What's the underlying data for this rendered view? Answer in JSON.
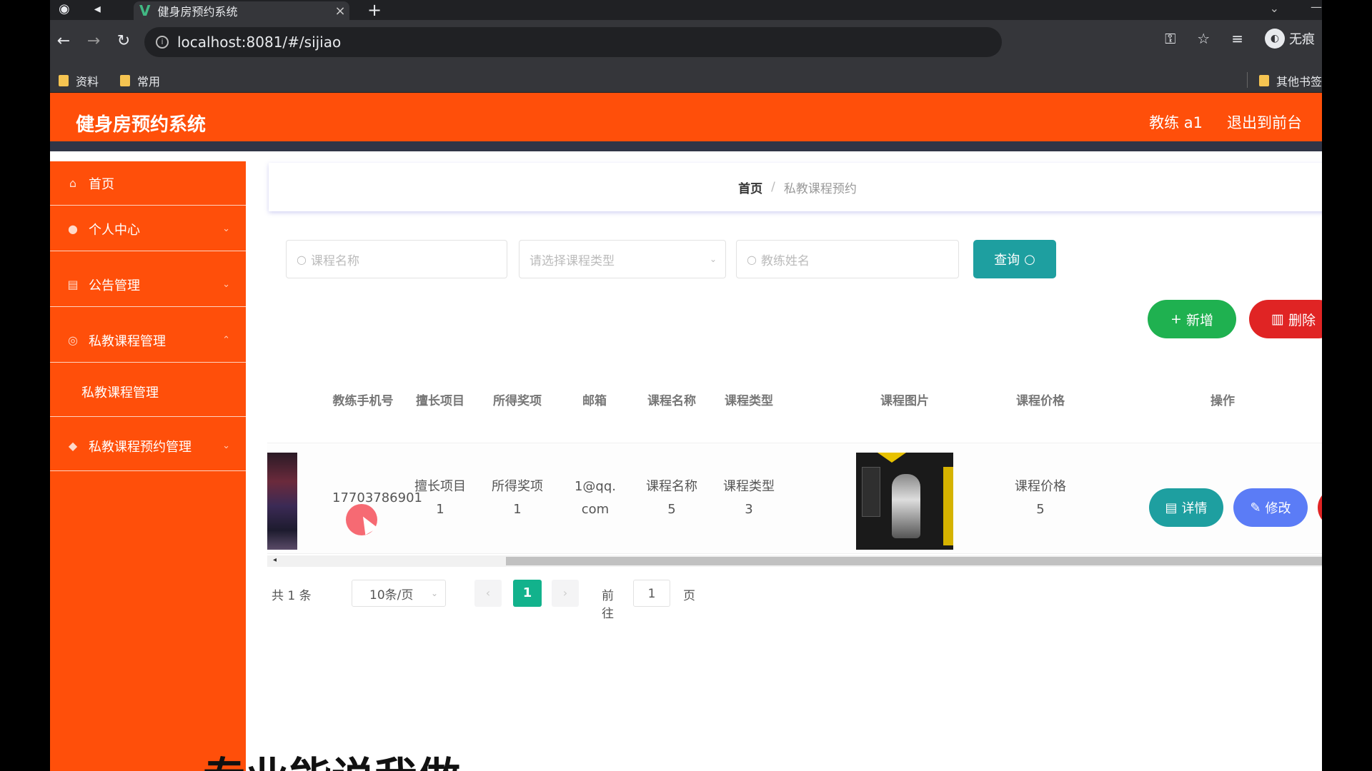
{
  "browser": {
    "tab_title": "健身房预约系统",
    "tab_logo": "V",
    "tab_close": "×",
    "new_tab": "+",
    "url": "localhost:8081/#/sijiao",
    "bookmarks": [
      "资料",
      "常用"
    ],
    "other_bookmarks": "其他书签",
    "profile_label": "无痕"
  },
  "header": {
    "title": "健身房预约系统",
    "user_label": "教练 a1",
    "logout_label": "退出到前台"
  },
  "sidebar": {
    "items": [
      {
        "label": "首页",
        "icon": "home-icon"
      },
      {
        "label": "个人中心",
        "icon": "user-icon"
      },
      {
        "label": "公告管理",
        "icon": "notice-icon"
      },
      {
        "label": "私教课程管理",
        "icon": "course-icon"
      },
      {
        "label": "私教课程预约管理",
        "icon": "booking-icon"
      }
    ],
    "submenu": {
      "label": "私教课程管理"
    }
  },
  "breadcrumb": {
    "home": "首页",
    "separator": "/",
    "current": "私教课程预约"
  },
  "search": {
    "course_name_placeholder": "课程名称",
    "course_type_placeholder": "请选择课程类型",
    "coach_name_placeholder": "教练姓名",
    "query_label": "查询"
  },
  "actions": {
    "add_label": "新增",
    "delete_label": "删除"
  },
  "table": {
    "headers": [
      "教练手机号",
      "擅长项目",
      "所得奖项",
      "邮箱",
      "课程名称",
      "课程类型",
      "课程图片",
      "课程价格",
      "操作"
    ],
    "rows": [
      {
        "phone": "17703786901",
        "specialty": "擅长项目1",
        "award": "所得奖项1",
        "email": "1@qq.com",
        "course_name": "课程名称5",
        "course_type": "课程类型3",
        "price": "课程价格5"
      }
    ],
    "row_actions": {
      "detail": "详情",
      "edit": "修改"
    }
  },
  "pagination": {
    "total": "共 1 条",
    "page_size": "10条/页",
    "current_page": "1",
    "goto_prefix": "前往",
    "goto_value": "1",
    "goto_suffix": "页"
  },
  "overlay_caption": "专业能说我做",
  "colors": {
    "brand": "#ff4f0a",
    "query": "#1e9fa0",
    "add": "#1fb150",
    "delete": "#e02424",
    "detail": "#1e9fa0",
    "edit": "#5b7cf6",
    "page_active": "#12b28c"
  }
}
